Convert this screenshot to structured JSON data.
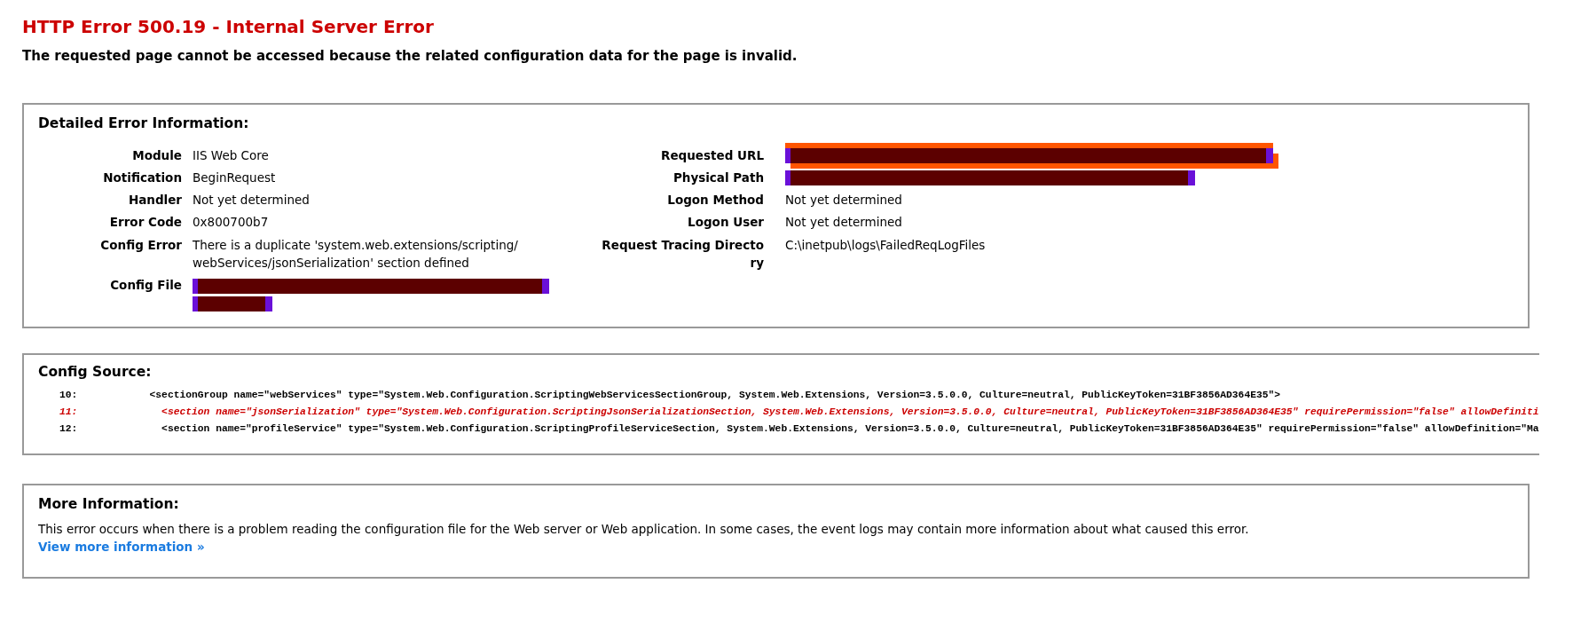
{
  "title": "HTTP Error 500.19 - Internal Server Error",
  "subtitle": "The requested page cannot be accessed because the related configuration data for the page is invalid.",
  "detailed": {
    "heading": "Detailed Error Information:",
    "left": [
      {
        "label": "Module",
        "kind": "text",
        "value": "IIS Web Core"
      },
      {
        "label": "Notification",
        "kind": "text",
        "value": "BeginRequest"
      },
      {
        "label": "Handler",
        "kind": "text",
        "value": "Not yet determined"
      },
      {
        "label": "Error Code",
        "kind": "text",
        "value": "0x800700b7"
      },
      {
        "label": "Config Error",
        "kind": "text",
        "value": "There is a duplicate 'system.web.extensions/scripting/webServices/jsonSerialization' section defined"
      },
      {
        "label": "Config File",
        "kind": "redacted",
        "marker": false
      }
    ],
    "right": [
      {
        "label": "Requested URL",
        "kind": "redacted",
        "marker": true
      },
      {
        "label": "Physical Path",
        "kind": "redacted",
        "marker": false
      },
      {
        "label": "Logon Method",
        "kind": "text",
        "value": "Not yet determined"
      },
      {
        "label": "Logon User",
        "kind": "text",
        "value": "Not yet determined"
      },
      {
        "label": "Request Tracing Directory",
        "kind": "text",
        "value": "C:\\inetpub\\logs\\FailedReqLogFiles"
      }
    ]
  },
  "config_source": {
    "heading": "Config Source:",
    "lines": [
      {
        "number": "10:",
        "code": "  <sectionGroup name=\"webServices\" type=\"System.Web.Configuration.ScriptingWebServicesSectionGroup, System.Web.Extensions, Version=3.5.0.0, Culture=neutral, PublicKeyToken=31BF3856AD364E35\">",
        "highlighted": false
      },
      {
        "number": "11:",
        "code": "    <section name=\"jsonSerialization\" type=\"System.Web.Configuration.ScriptingJsonSerializationSection, System.Web.Extensions, Version=3.5.0.0, Culture=neutral, PublicKeyToken=31BF3856AD364E35\" requirePermission=\"false\" allowDefiniti",
        "highlighted": true
      },
      {
        "number": "12:",
        "code": "    <section name=\"profileService\" type=\"System.Web.Configuration.ScriptingProfileServiceSection, System.Web.Extensions, Version=3.5.0.0, Culture=neutral, PublicKeyToken=31BF3856AD364E35\" requirePermission=\"false\" allowDefinition=\"Ma",
        "highlighted": false
      }
    ]
  },
  "more_info": {
    "heading": "More Information:",
    "text": "This error occurs when there is a problem reading the configuration file for the Web server or Web application. In some cases, the event logs may contain more information about what caused this error.",
    "link": "View more information »"
  }
}
